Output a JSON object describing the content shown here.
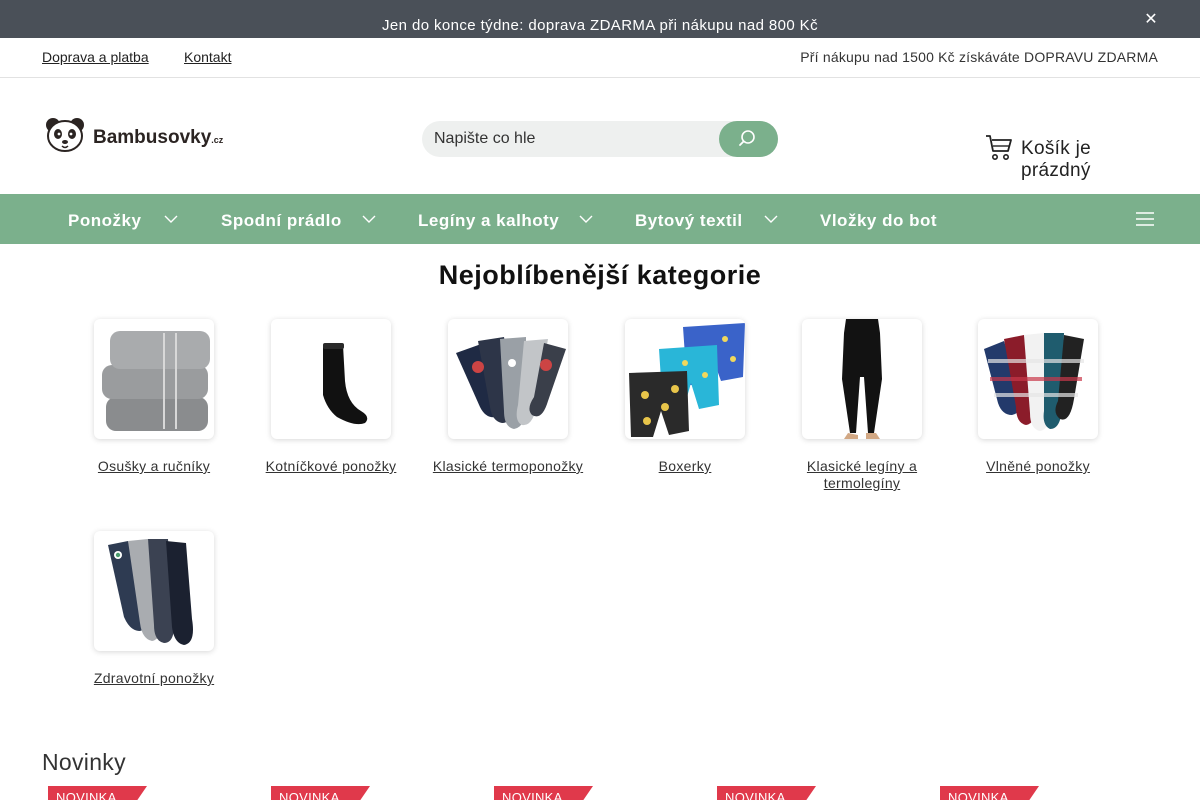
{
  "announcement": {
    "text": "Jen do konce týdne: doprava ZDARMA při nákupu nad 800 Kč",
    "close": "✕"
  },
  "topbar": {
    "links": [
      "Doprava a platba",
      "Kontakt"
    ],
    "promo": "Pří  nákupu nad 1500 Kč získáváte DOPRAVU ZDARMA"
  },
  "header": {
    "logo": {
      "name": "Bambusovky",
      "suffix": ".cz"
    },
    "search": {
      "placeholder": "Napište co hle",
      "icon": "search-icon"
    },
    "cart": {
      "label": "Košík je prázdný",
      "icon": "cart-icon"
    }
  },
  "nav": {
    "items": [
      "Ponožky",
      "Spodní prádlo",
      "Legíny a kalhoty",
      "Bytový textil",
      "Vložky do bot"
    ],
    "menu_icon": "hamburger-icon"
  },
  "categories": {
    "title": "Nejoblíbenější kategorie",
    "items": [
      "Osušky a ručníky",
      "Kotníčkové ponožky",
      "Klasické termoponožky",
      "Boxerky",
      "Klasické legíny a termolegíny",
      "Vlněné ponožky",
      "Zdravotní ponožky"
    ]
  },
  "news": {
    "title": "Novinky",
    "badge": "NOVINKA",
    "badge_count": 5
  },
  "colors": {
    "accent": "#7bb08c",
    "announcement_bg": "#4a5058",
    "badge": "#e0394b"
  }
}
